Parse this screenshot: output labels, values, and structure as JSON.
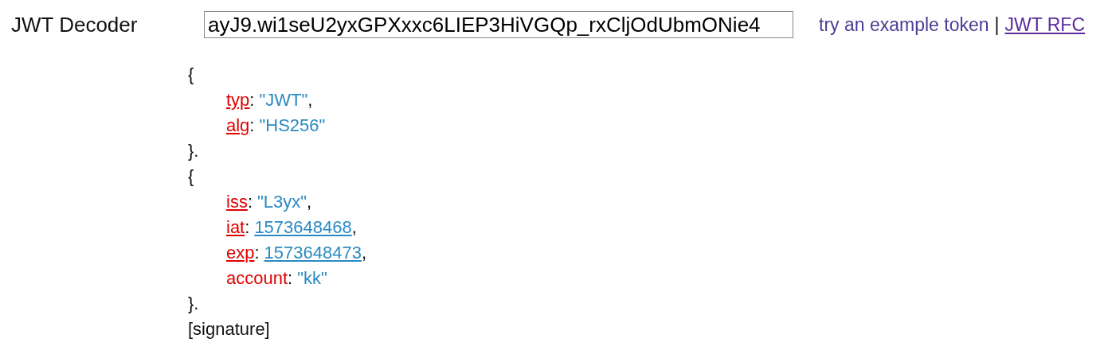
{
  "title": "JWT Decoder",
  "token": {
    "value": "ayJ9.wi1seU2yxGPXxxc6LIEP3HiVGQp_rxCljOdUbmONie4"
  },
  "links": [
    {
      "kind": "plain",
      "label": "try an example token"
    },
    {
      "kind": "separator",
      "label": "|"
    },
    {
      "kind": "underlined",
      "label": "JWT RFC"
    }
  ],
  "sections": [
    {
      "open": "{",
      "close": "}.",
      "entries": [
        {
          "key": "typ",
          "key_underlined": true,
          "sep": ":",
          "value": "\"JWT\"",
          "kind": "string",
          "trail": ","
        },
        {
          "key": "alg",
          "key_underlined": true,
          "sep": ":",
          "value": "\"HS256\"",
          "kind": "string"
        }
      ]
    },
    {
      "open": "{",
      "close": "}.",
      "entries": [
        {
          "key": "iss",
          "key_underlined": true,
          "sep": ":",
          "value": "\"L3yx\"",
          "kind": "string",
          "trail": ","
        },
        {
          "key": "iat",
          "key_underlined": true,
          "sep": ":",
          "value": "1573648468",
          "kind": "number",
          "trail": ","
        },
        {
          "key": "exp",
          "key_underlined": true,
          "sep": ":",
          "value": "1573648473",
          "kind": "number",
          "trail": ","
        },
        {
          "key": "account",
          "key_underlined": false,
          "sep": ":",
          "value": "\"kk\"",
          "kind": "string"
        }
      ]
    }
  ],
  "signature": "[signature]"
}
